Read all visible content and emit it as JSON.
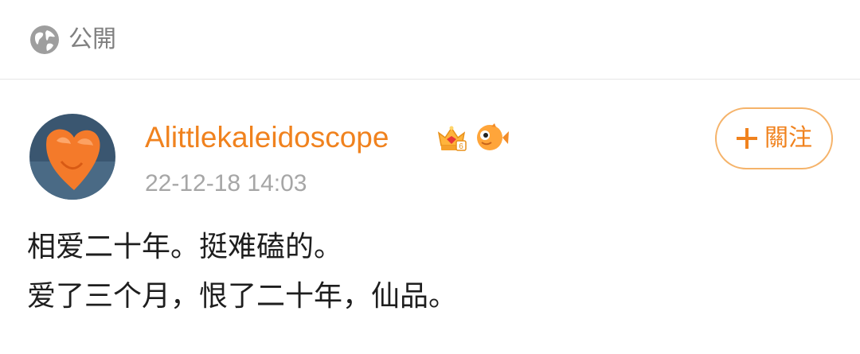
{
  "visibility": {
    "icon": "globe-icon",
    "label": "公開"
  },
  "post": {
    "author": {
      "name": "Alittlekaleidoscope",
      "badges": [
        "vip-crown-icon",
        "fish-icon"
      ]
    },
    "timestamp": "22-12-18 14:03",
    "follow_label": "關注",
    "lines": [
      "相爱二十年。挺难磕的。",
      "爱了三个月，恨了二十年，仙品。"
    ]
  },
  "colors": {
    "accent": "#f0821e",
    "muted": "#a6a6a6",
    "text": "#1e1e1e"
  }
}
